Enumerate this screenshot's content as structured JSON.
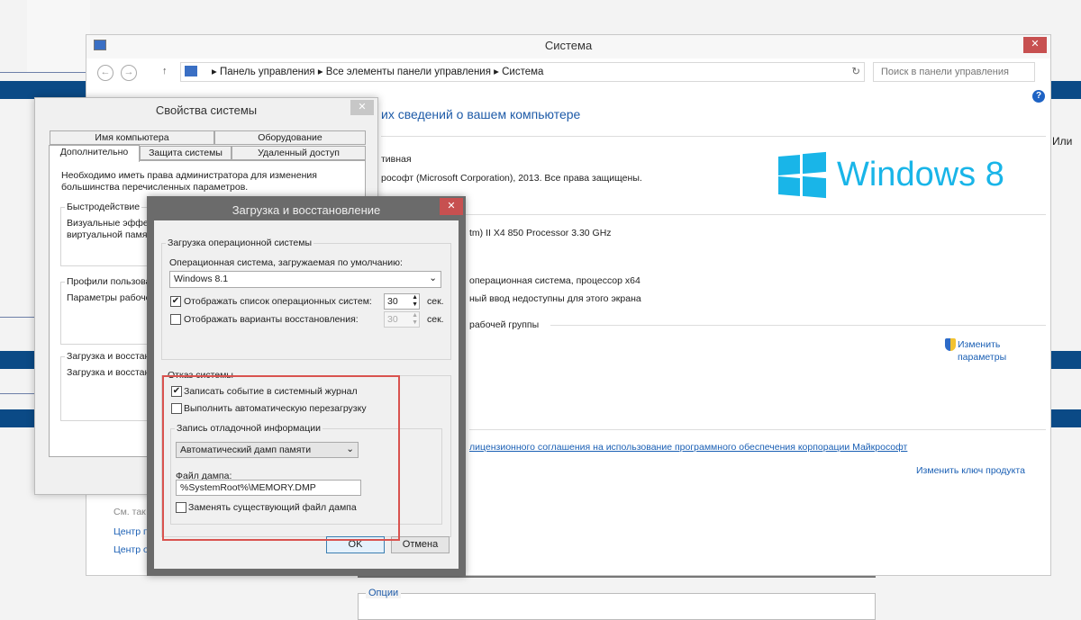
{
  "background": {
    "right_text": "Или"
  },
  "system_window": {
    "title": "Система",
    "breadcrumb": [
      "Панель управления",
      "Все элементы панели управления",
      "Система"
    ],
    "search_placeholder": "Поиск в панели управления",
    "heading_partial": "их сведений о вашем компьютере",
    "edition_partial": "тивная",
    "copyright_partial": "рософт (Microsoft Corporation), 2013. Все права защищены.",
    "logo_text": "Windows 8",
    "processor_partial": "tm) II X4 850 Processor   3.30 GHz",
    "system_type_partial": "операционная система, процессор x64",
    "pen_partial": "ный ввод недоступны для этого экрана",
    "workgroup_partial": "рабочей группы",
    "change_settings": [
      "Изменить",
      "параметры"
    ],
    "license_link_partial": "лицензионного соглашения на использование программного обеспечения корпорации Майкрософт",
    "change_key": "Изменить ключ продукта",
    "see_also_partial": "См. так",
    "side_links": [
      "Центр п",
      "Центр о"
    ],
    "options_label": "Опции"
  },
  "sys_props": {
    "title": "Свойства системы",
    "tabs_row1": [
      "Имя компьютера",
      "Оборудование"
    ],
    "tabs_row2": [
      "Дополнительно",
      "Защита системы",
      "Удаленный доступ"
    ],
    "admin_note": "Необходимо иметь права администратора для изменения большинства перечисленных параметров.",
    "perf_label": "Быстродействие",
    "perf_text": "Визуальные эффекты",
    "perf_text2": "виртуальной памяти",
    "profiles_label": "Профили пользоват",
    "profiles_text": "Параметры рабочег",
    "boot_label": "Загрузка и восстан",
    "boot_text": "Загрузка и восстан"
  },
  "boot_dialog": {
    "title": "Загрузка и восстановление",
    "os_group": "Загрузка операционной системы",
    "default_os_label": "Операционная система, загружаемая по умолчанию:",
    "default_os_value": "Windows 8.1",
    "show_list_label": "Отображать список операционных систем:",
    "show_list_checked": true,
    "show_list_value": "30",
    "show_recovery_label": "Отображать варианты восстановления:",
    "show_recovery_checked": false,
    "show_recovery_value": "30",
    "sec": "сек.",
    "failure_group": "Отказ системы",
    "write_event_label": "Записать событие в системный журнал",
    "write_event_checked": true,
    "auto_restart_label": "Выполнить автоматическую перезагрузку",
    "auto_restart_checked": false,
    "debug_group": "Запись отладочной информации",
    "dump_type": "Автоматический дамп памяти",
    "dump_file_label": "Файл дампа:",
    "dump_file_value": "%SystemRoot%\\MEMORY.DMP",
    "overwrite_label": "Заменять существующий файл дампа",
    "overwrite_checked": false,
    "ok": "OK",
    "cancel": "Отмена"
  },
  "colors": {
    "highlight": "#d9534f",
    "win8_blue": "#19b5e8"
  }
}
